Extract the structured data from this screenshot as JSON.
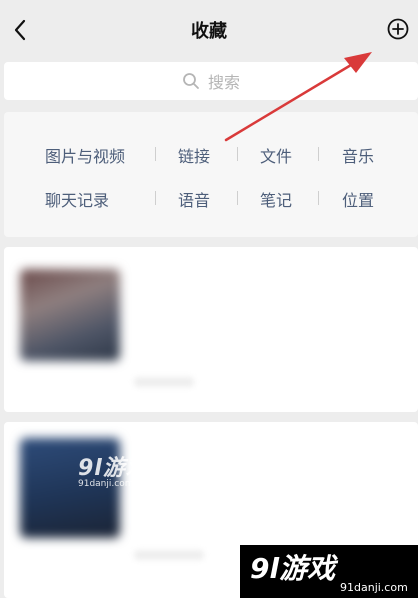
{
  "header": {
    "title": "收藏",
    "back_icon": "chevron-left-icon",
    "add_icon": "plus-circle-icon"
  },
  "search": {
    "placeholder": "搜索",
    "icon": "search-icon"
  },
  "categories": [
    {
      "label": "图片与视频"
    },
    {
      "label": "链接"
    },
    {
      "label": "文件"
    },
    {
      "label": "音乐"
    },
    {
      "label": "聊天记录"
    },
    {
      "label": "语音"
    },
    {
      "label": "笔记"
    },
    {
      "label": "位置"
    }
  ],
  "watermark": {
    "brand_mark": "9l游戏",
    "url": "91danji.com"
  },
  "colors": {
    "background": "#ededed",
    "category_text": "#4d5e7a",
    "annotation_arrow": "#d93a3a"
  }
}
